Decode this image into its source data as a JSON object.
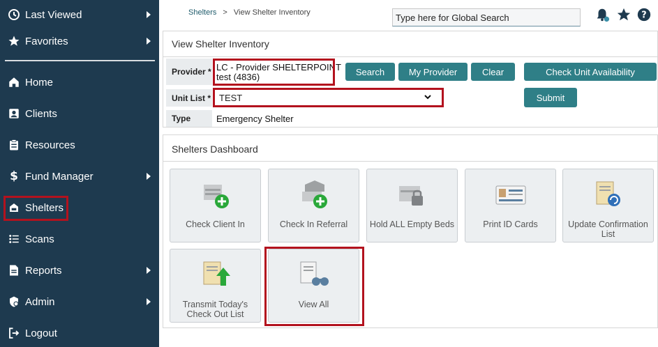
{
  "sidebar": {
    "items": [
      {
        "label": "Last Viewed",
        "icon": "history-icon"
      },
      {
        "label": "Favorites",
        "icon": "star-icon"
      },
      {
        "label": "Home",
        "icon": "home-icon"
      },
      {
        "label": "Clients",
        "icon": "client-card-icon"
      },
      {
        "label": "Resources",
        "icon": "clipboard-icon"
      },
      {
        "label": "Fund Manager",
        "icon": "dollar-icon"
      },
      {
        "label": "Shelters",
        "icon": "shelter-icon"
      },
      {
        "label": "Scans",
        "icon": "scans-list-icon"
      },
      {
        "label": "Reports",
        "icon": "report-icon"
      },
      {
        "label": "Admin",
        "icon": "admin-gear-icon"
      },
      {
        "label": "Logout",
        "icon": "logout-icon"
      }
    ]
  },
  "header": {
    "breadcrumb_link": "Shelters",
    "breadcrumb_sep": ">",
    "breadcrumb_current": "View Shelter Inventory",
    "search_placeholder": "Type here for Global Search"
  },
  "inventory": {
    "title": "View Shelter Inventory",
    "provider_label": "Provider *",
    "provider_line1": "LC - Provider SHELTERPOINT",
    "provider_line2": "test (4836)",
    "unit_list_label": "Unit List *",
    "unit_list_value": "TEST",
    "type_label": "Type",
    "type_value": "Emergency Shelter",
    "buttons": {
      "search": "Search",
      "my_provider": "My Provider",
      "clear": "Clear",
      "check_unit": "Check Unit Availability",
      "submit": "Submit"
    }
  },
  "dashboard": {
    "title": "Shelters Dashboard",
    "tiles": [
      {
        "line1": "Check Client In",
        "line2": ""
      },
      {
        "line1": "Check In Referral",
        "line2": ""
      },
      {
        "line1": "Hold ALL Empty Beds",
        "line2": ""
      },
      {
        "line1": "Print ID Cards",
        "line2": ""
      },
      {
        "line1": "Update Confirmation",
        "line2": "List"
      },
      {
        "line1": "Transmit Today's",
        "line2": "Check Out List"
      },
      {
        "line1": "View All",
        "line2": ""
      }
    ]
  },
  "colors": {
    "sidebar_bg": "#1e3a4f",
    "button_teal": "#2f7f87",
    "highlight_red": "#b3121e"
  }
}
